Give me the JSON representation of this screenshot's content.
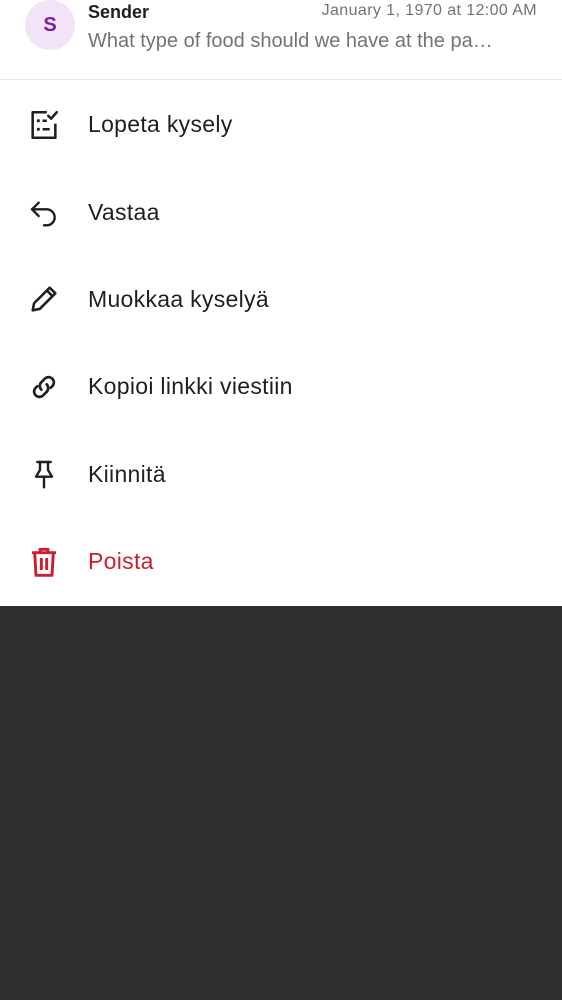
{
  "header": {
    "avatar_initial": "S",
    "sender": "Sender",
    "timestamp": "January 1, 1970 at 12:00 AM",
    "preview": "What type of food should we have at the pa…"
  },
  "menu": {
    "items": [
      {
        "label": "Lopeta kysely",
        "icon": "poll-checklist-icon"
      },
      {
        "label": "Vastaa",
        "icon": "reply-arrow-icon"
      },
      {
        "label": "Muokkaa kyselyä",
        "icon": "pencil-icon"
      },
      {
        "label": "Kopioi linkki viestiin",
        "icon": "link-icon"
      },
      {
        "label": "Kiinnitä",
        "icon": "pin-icon"
      },
      {
        "label": "Poista",
        "icon": "trash-icon"
      }
    ]
  },
  "colors": {
    "danger": "#cf1c2e",
    "avatar_bg": "#f3e3f7",
    "avatar_fg": "#7b1fa2",
    "backdrop": "#303030"
  }
}
